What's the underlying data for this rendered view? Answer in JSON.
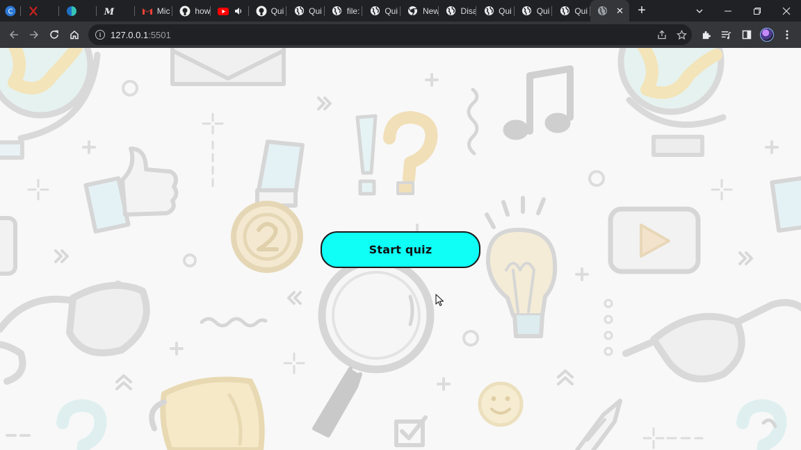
{
  "tabs": [
    {
      "title": "",
      "icon": "cortana-icon"
    },
    {
      "title": "",
      "icon": "x-logo-icon"
    },
    {
      "title": "",
      "icon": "edge-icon"
    },
    {
      "title": "",
      "icon": "medium-icon"
    },
    {
      "title": "Mic",
      "icon": "gmail-icon"
    },
    {
      "title": "how",
      "icon": "github-icon"
    },
    {
      "title": "",
      "icon": "youtube-icon"
    },
    {
      "title": "Qui",
      "icon": "github-icon"
    },
    {
      "title": "Qui",
      "icon": "globe-icon"
    },
    {
      "title": "file:",
      "icon": "globe-icon"
    },
    {
      "title": "Qui",
      "icon": "globe-icon"
    },
    {
      "title": "New",
      "icon": "chrome-icon"
    },
    {
      "title": "Disa",
      "icon": "globe-icon"
    },
    {
      "title": "Qui",
      "icon": "globe-icon"
    },
    {
      "title": "Qui",
      "icon": "globe-icon"
    },
    {
      "title": "Qui",
      "icon": "globe-icon"
    },
    {
      "title": "Qui",
      "icon": "globe-icon"
    }
  ],
  "address": {
    "host": "127.0.0.1",
    "port": ":5501"
  },
  "page": {
    "start_button_label": "Start quiz"
  },
  "colors": {
    "button_bg": "#0ffff7",
    "tabstrip_bg": "#202124",
    "toolbar_bg": "#35363a"
  }
}
